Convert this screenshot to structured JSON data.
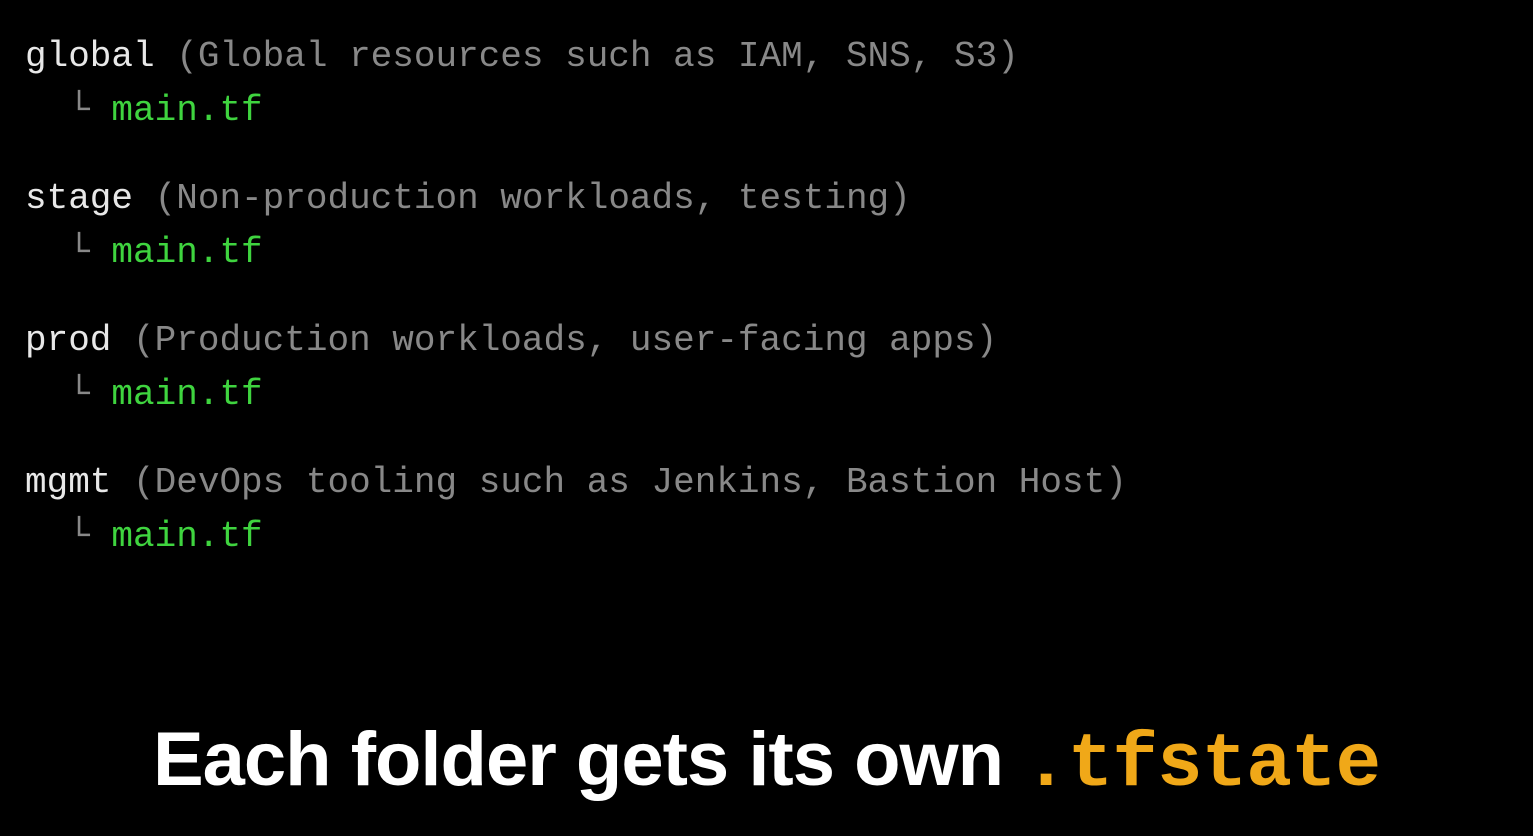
{
  "folders": [
    {
      "name": "global",
      "desc": "(Global resources such as IAM, SNS, S3)",
      "branch": "  └ ",
      "file": "main.tf"
    },
    {
      "name": "stage",
      "desc": "(Non-production workloads, testing)",
      "branch": "  └ ",
      "file": "main.tf"
    },
    {
      "name": "prod",
      "desc": "(Production workloads, user-facing apps)",
      "branch": "  └ ",
      "file": "main.tf"
    },
    {
      "name": "mgmt",
      "desc": "(DevOps tooling such as Jenkins, Bastion Host)",
      "branch": "  └ ",
      "file": "main.tf"
    }
  ],
  "caption": {
    "text": "Each folder gets its own ",
    "highlight": ".tfstate"
  }
}
